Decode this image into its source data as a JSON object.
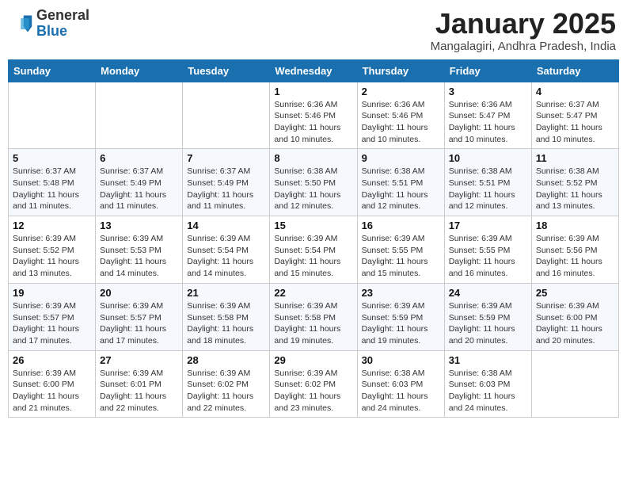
{
  "logo": {
    "general": "General",
    "blue": "Blue"
  },
  "header": {
    "title": "January 2025",
    "subtitle": "Mangalagiri, Andhra Pradesh, India"
  },
  "days_of_week": [
    "Sunday",
    "Monday",
    "Tuesday",
    "Wednesday",
    "Thursday",
    "Friday",
    "Saturday"
  ],
  "weeks": [
    [
      {
        "day": "",
        "info": ""
      },
      {
        "day": "",
        "info": ""
      },
      {
        "day": "",
        "info": ""
      },
      {
        "day": "1",
        "info": "Sunrise: 6:36 AM\nSunset: 5:46 PM\nDaylight: 11 hours and 10 minutes."
      },
      {
        "day": "2",
        "info": "Sunrise: 6:36 AM\nSunset: 5:46 PM\nDaylight: 11 hours and 10 minutes."
      },
      {
        "day": "3",
        "info": "Sunrise: 6:36 AM\nSunset: 5:47 PM\nDaylight: 11 hours and 10 minutes."
      },
      {
        "day": "4",
        "info": "Sunrise: 6:37 AM\nSunset: 5:47 PM\nDaylight: 11 hours and 10 minutes."
      }
    ],
    [
      {
        "day": "5",
        "info": "Sunrise: 6:37 AM\nSunset: 5:48 PM\nDaylight: 11 hours and 11 minutes."
      },
      {
        "day": "6",
        "info": "Sunrise: 6:37 AM\nSunset: 5:49 PM\nDaylight: 11 hours and 11 minutes."
      },
      {
        "day": "7",
        "info": "Sunrise: 6:37 AM\nSunset: 5:49 PM\nDaylight: 11 hours and 11 minutes."
      },
      {
        "day": "8",
        "info": "Sunrise: 6:38 AM\nSunset: 5:50 PM\nDaylight: 11 hours and 12 minutes."
      },
      {
        "day": "9",
        "info": "Sunrise: 6:38 AM\nSunset: 5:51 PM\nDaylight: 11 hours and 12 minutes."
      },
      {
        "day": "10",
        "info": "Sunrise: 6:38 AM\nSunset: 5:51 PM\nDaylight: 11 hours and 12 minutes."
      },
      {
        "day": "11",
        "info": "Sunrise: 6:38 AM\nSunset: 5:52 PM\nDaylight: 11 hours and 13 minutes."
      }
    ],
    [
      {
        "day": "12",
        "info": "Sunrise: 6:39 AM\nSunset: 5:52 PM\nDaylight: 11 hours and 13 minutes."
      },
      {
        "day": "13",
        "info": "Sunrise: 6:39 AM\nSunset: 5:53 PM\nDaylight: 11 hours and 14 minutes."
      },
      {
        "day": "14",
        "info": "Sunrise: 6:39 AM\nSunset: 5:54 PM\nDaylight: 11 hours and 14 minutes."
      },
      {
        "day": "15",
        "info": "Sunrise: 6:39 AM\nSunset: 5:54 PM\nDaylight: 11 hours and 15 minutes."
      },
      {
        "day": "16",
        "info": "Sunrise: 6:39 AM\nSunset: 5:55 PM\nDaylight: 11 hours and 15 minutes."
      },
      {
        "day": "17",
        "info": "Sunrise: 6:39 AM\nSunset: 5:55 PM\nDaylight: 11 hours and 16 minutes."
      },
      {
        "day": "18",
        "info": "Sunrise: 6:39 AM\nSunset: 5:56 PM\nDaylight: 11 hours and 16 minutes."
      }
    ],
    [
      {
        "day": "19",
        "info": "Sunrise: 6:39 AM\nSunset: 5:57 PM\nDaylight: 11 hours and 17 minutes."
      },
      {
        "day": "20",
        "info": "Sunrise: 6:39 AM\nSunset: 5:57 PM\nDaylight: 11 hours and 17 minutes."
      },
      {
        "day": "21",
        "info": "Sunrise: 6:39 AM\nSunset: 5:58 PM\nDaylight: 11 hours and 18 minutes."
      },
      {
        "day": "22",
        "info": "Sunrise: 6:39 AM\nSunset: 5:58 PM\nDaylight: 11 hours and 19 minutes."
      },
      {
        "day": "23",
        "info": "Sunrise: 6:39 AM\nSunset: 5:59 PM\nDaylight: 11 hours and 19 minutes."
      },
      {
        "day": "24",
        "info": "Sunrise: 6:39 AM\nSunset: 5:59 PM\nDaylight: 11 hours and 20 minutes."
      },
      {
        "day": "25",
        "info": "Sunrise: 6:39 AM\nSunset: 6:00 PM\nDaylight: 11 hours and 20 minutes."
      }
    ],
    [
      {
        "day": "26",
        "info": "Sunrise: 6:39 AM\nSunset: 6:00 PM\nDaylight: 11 hours and 21 minutes."
      },
      {
        "day": "27",
        "info": "Sunrise: 6:39 AM\nSunset: 6:01 PM\nDaylight: 11 hours and 22 minutes."
      },
      {
        "day": "28",
        "info": "Sunrise: 6:39 AM\nSunset: 6:02 PM\nDaylight: 11 hours and 22 minutes."
      },
      {
        "day": "29",
        "info": "Sunrise: 6:39 AM\nSunset: 6:02 PM\nDaylight: 11 hours and 23 minutes."
      },
      {
        "day": "30",
        "info": "Sunrise: 6:38 AM\nSunset: 6:03 PM\nDaylight: 11 hours and 24 minutes."
      },
      {
        "day": "31",
        "info": "Sunrise: 6:38 AM\nSunset: 6:03 PM\nDaylight: 11 hours and 24 minutes."
      },
      {
        "day": "",
        "info": ""
      }
    ]
  ]
}
